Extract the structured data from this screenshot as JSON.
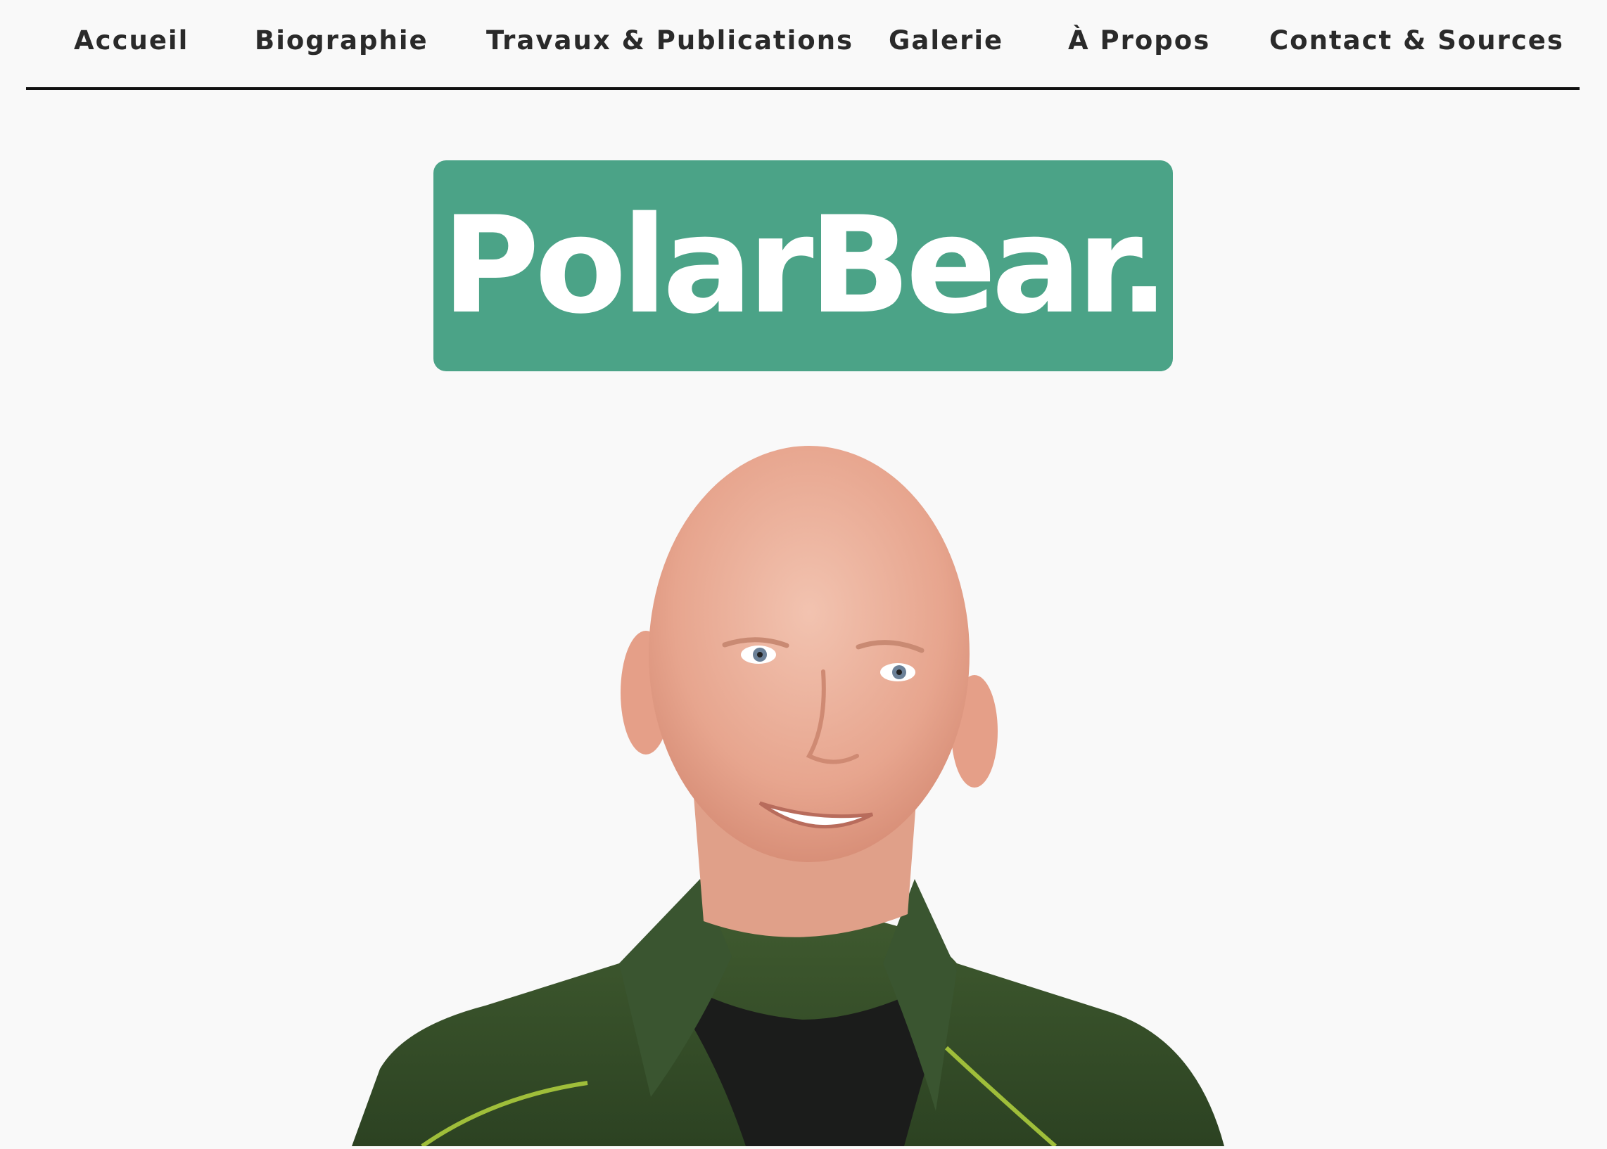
{
  "nav": {
    "items": [
      {
        "label": "Accueil"
      },
      {
        "label": "Biographie"
      },
      {
        "label": "Travaux & Publications"
      },
      {
        "label": "Galerie"
      },
      {
        "label": "À Propos"
      },
      {
        "label": "Contact & Sources"
      }
    ]
  },
  "logo": {
    "text": "PolarBear."
  },
  "colors": {
    "background": "#f9f9f9",
    "brand_green": "#4ba387",
    "nav_text": "#2a2a2a",
    "rule": "#111111"
  }
}
